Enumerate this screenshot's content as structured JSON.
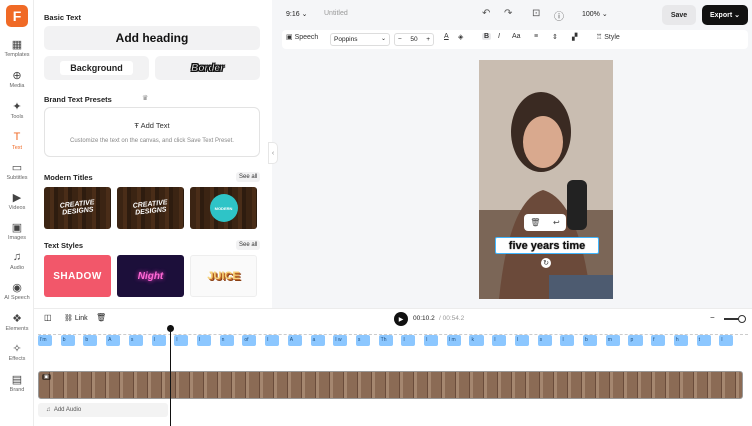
{
  "app": {
    "logo_letter": "F"
  },
  "rail": [
    {
      "label": "Templates",
      "icon": "▦"
    },
    {
      "label": "Media",
      "icon": "⊕"
    },
    {
      "label": "Tools",
      "icon": "✦"
    },
    {
      "label": "Text",
      "icon": "T"
    },
    {
      "label": "Subtitles",
      "icon": "▭"
    },
    {
      "label": "Videos",
      "icon": "▶"
    },
    {
      "label": "Images",
      "icon": "▣"
    },
    {
      "label": "Audio",
      "icon": "♫"
    },
    {
      "label": "AI Speech",
      "icon": "◉"
    },
    {
      "label": "Elements",
      "icon": "❖"
    },
    {
      "label": "Effects",
      "icon": "✧"
    },
    {
      "label": "Brand",
      "icon": "▤"
    }
  ],
  "panel": {
    "basic_text": "Basic Text",
    "add_heading": "Add heading",
    "background": "Background",
    "border": "Border",
    "brand_presets": "Brand Text Presets",
    "add_text": "Add Text",
    "preset_hint": "Customize the text on the canvas, and click Save Text Preset.",
    "modern_titles": "Modern Titles",
    "see_all": "See all",
    "text_styles": "Text Styles",
    "mt_1": "CREATIVE DESIGNS",
    "mt_2": "CREATIVE DESIGNS",
    "mt_3": "MODERN",
    "ts_1": "SHADOW",
    "ts_2": "Night",
    "ts_3": "JUICE"
  },
  "topbar": {
    "ratio": "9:16",
    "title": "Untitled",
    "zoom": "100%",
    "save": "Save",
    "export": "Export"
  },
  "format": {
    "speech": "Speech",
    "font": "Poppins",
    "size": "50",
    "style": "Style"
  },
  "caption": {
    "text": "five years time"
  },
  "timeline": {
    "link": "Link",
    "time_current": "00:10.2",
    "time_total": "/ 00:54.2",
    "add_audio": "Add Audio",
    "subtitles": [
      "I'm",
      "b",
      "b",
      "A",
      "s",
      "I",
      "I",
      "I",
      "n",
      "of",
      "I",
      "A",
      "a",
      "I w",
      "s",
      "Th",
      "I",
      "I",
      "I m",
      "k",
      "I",
      "I",
      "s",
      "I",
      "b",
      "m",
      "p",
      "f",
      "h",
      "t",
      "I"
    ]
  },
  "colors": {
    "accent": "#f06a26",
    "selection": "#3fb6ff",
    "subtitle_clip": "#8cc7ff"
  }
}
